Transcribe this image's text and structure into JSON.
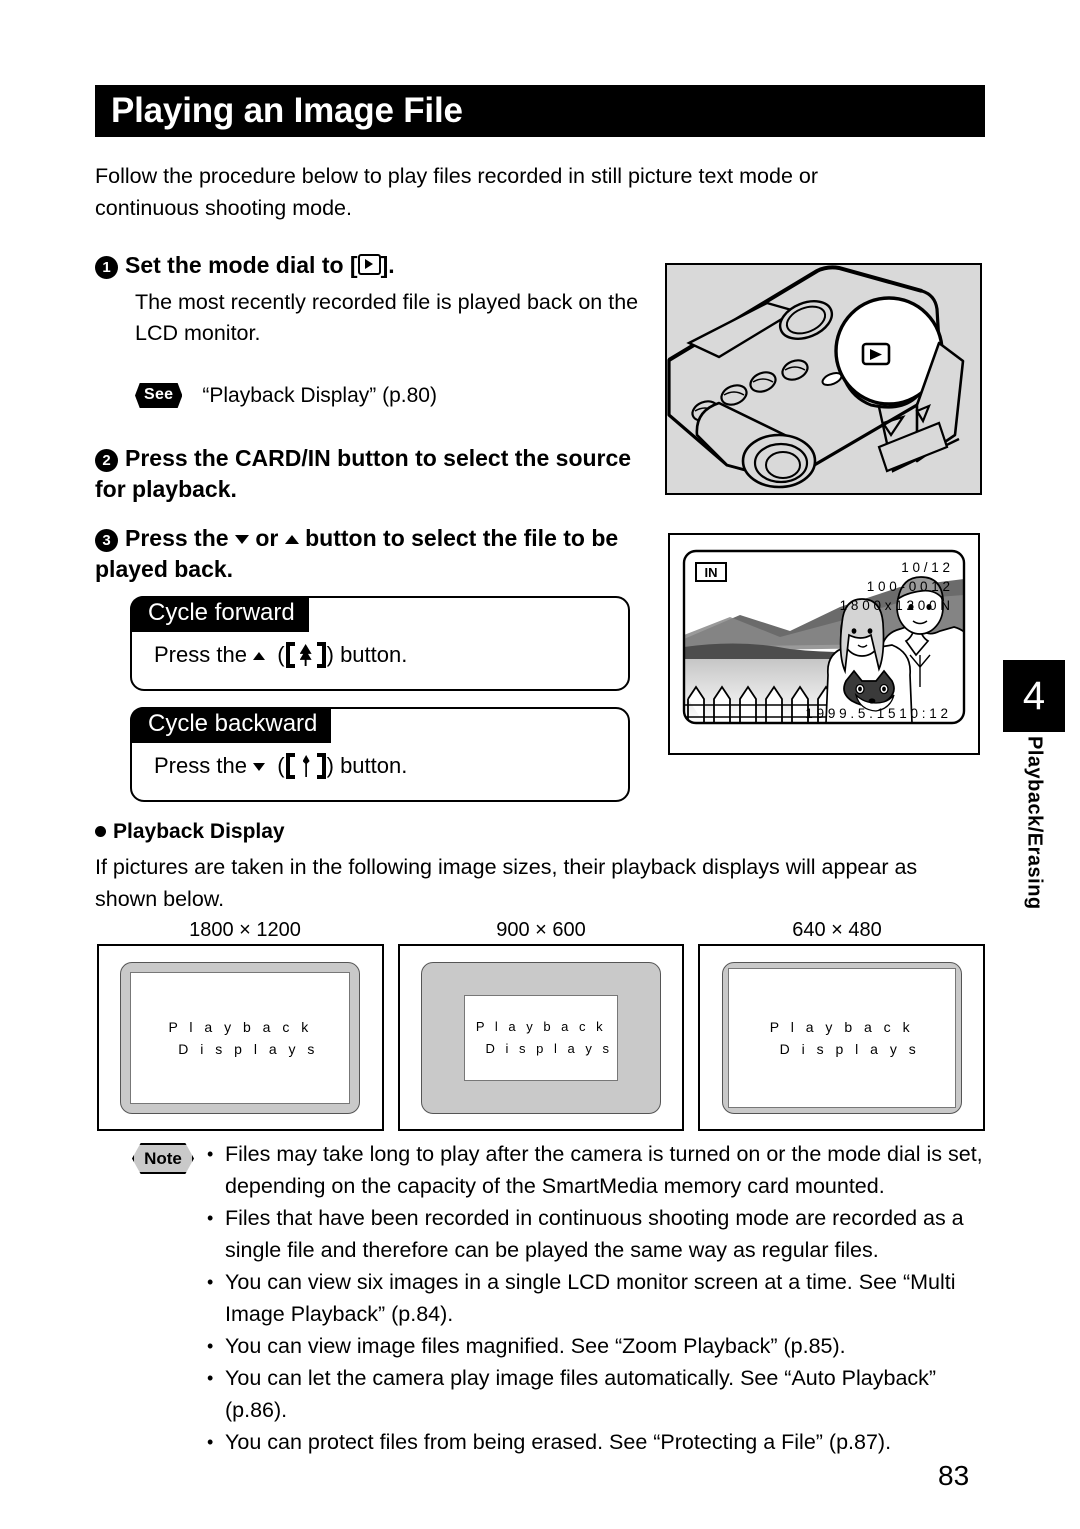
{
  "page": {
    "title": "Playing an Image File",
    "number": "83"
  },
  "intro": "Follow the procedure below to play files recorded in still picture text mode or continuous shooting mode.",
  "steps": {
    "one": {
      "num": "1",
      "heading_before": "Set the mode dial to [",
      "heading_after": "].",
      "body": "The most recently recorded file is played back on the LCD monitor.",
      "see_badge": "See",
      "see_text": "“Playback Display” (p.80)"
    },
    "two": {
      "num": "2",
      "heading": "Press the CARD/IN  button to select  the source for playback."
    },
    "three": {
      "num": "3",
      "heading_a": "Press the",
      "heading_b": "or",
      "heading_c": "button to select the file to be played back."
    }
  },
  "cycle": {
    "forward": {
      "title": "Cycle forward",
      "text_a": "Press the",
      "text_b": "(",
      "text_c": ") button.",
      "icon": "bracket-tree-button-icon"
    },
    "backward": {
      "title": "Cycle backward",
      "text_a": "Press the",
      "text_b": "(",
      "text_c": ") button.",
      "icon": "bracket-person-button-icon"
    }
  },
  "camera_figure": {
    "name": "camera-top-mode-dial-illustration",
    "dial_symbol": "playback-mode-icon"
  },
  "lcd_figure": {
    "name": "lcd-playback-screen-illustration",
    "source_badge": "IN",
    "frame_counter": "1 0 / 1 2",
    "file_number": "1 0 0 - 0 0 1 2",
    "image_size": "1 8 0 0 x 1 2 0 0    N",
    "datestamp": "1 9 9 9 .  5 . 1 5    1 0 : 1 2"
  },
  "chapter_tab": {
    "number": "4",
    "label": "Playback/Erasing"
  },
  "playback_display": {
    "heading": "Playback Display",
    "description": "If pictures are taken in the following image sizes, their playback displays will appear as shown below.",
    "boxes": [
      {
        "size_label": "1800 × 1200",
        "line1": "P l a y b a c k",
        "line2": "D i s p l a y s"
      },
      {
        "size_label": "900 × 600",
        "line1": "P l a y b a c k",
        "line2": "D i s p l a y s"
      },
      {
        "size_label": "640 × 480",
        "line1": "P l a y b a c k",
        "line2": "D i s p l a y s"
      }
    ]
  },
  "note": {
    "badge": "Note",
    "items": [
      "Files may take long to play after the camera is turned on or the mode dial is set, depending on the capacity of the SmartMedia memory card mounted.",
      "Files that have been recorded in continuous shooting mode are recorded as a single file and therefore can be played the same way as regular files.",
      "You can view six images in a single LCD monitor screen at a time.  See “Multi Image Playback” (p.84).",
      "You can view image files magnified.  See “Zoom Playback” (p.85).",
      "You can let the camera play image files automatically.  See “Auto Playback” (p.86).",
      "You can protect files from being erased.  See “Protecting a File” (p.87)."
    ]
  }
}
